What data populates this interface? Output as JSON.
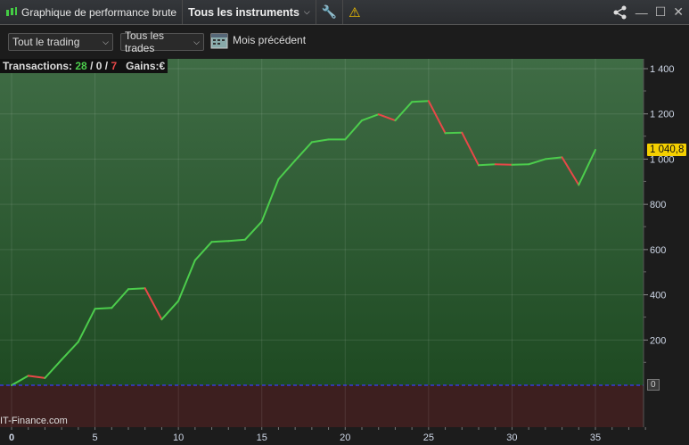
{
  "titlebar": {
    "title": "Graphique de performance brute",
    "instruments": "Tous les instruments"
  },
  "toolbar": {
    "scope": "Tout le trading",
    "trades": "Tous les trades",
    "period": "Mois précédent"
  },
  "stats": {
    "label": "Transactions:",
    "wins": "28",
    "sep1": " / ",
    "neutral": "0",
    "sep2": " / ",
    "losses": "7",
    "gains_label": "Gains:€"
  },
  "watermark": "IT-Finance.com",
  "colors": {
    "up": "#4ccd4c",
    "down": "#e84848",
    "wins": "#4ccd4c",
    "losses": "#e84848"
  },
  "chart_data": {
    "type": "line",
    "x": [
      0,
      1,
      2,
      3,
      4,
      5,
      6,
      7,
      8,
      9,
      10,
      11,
      12,
      13,
      14,
      15,
      16,
      17,
      18,
      19,
      20,
      21,
      22,
      23,
      24,
      25,
      26,
      27,
      28,
      29,
      30,
      31,
      32,
      33,
      34,
      35
    ],
    "values": [
      0,
      42,
      32,
      113,
      192,
      338,
      342,
      425,
      429,
      291,
      373,
      553,
      634,
      638,
      644,
      724,
      911,
      994,
      1075,
      1087,
      1087,
      1171,
      1198,
      1171,
      1253,
      1257,
      1115,
      1117,
      973,
      977,
      975,
      977,
      1000,
      1008,
      886,
      1040.8
    ],
    "last_value_label": "1 040,8",
    "zero_label": "0",
    "xlim": [
      0,
      38
    ],
    "ylim": [
      -180,
      1460
    ],
    "xticks": [
      "0",
      "5",
      "10",
      "15",
      "20",
      "25",
      "30",
      "35"
    ],
    "yticks": [
      {
        "v": 1400,
        "label": "1 400"
      },
      {
        "v": 1200,
        "label": "1 200"
      },
      {
        "v": 1000,
        "label": "1 000"
      },
      {
        "v": 800,
        "label": "800"
      },
      {
        "v": 600,
        "label": "600"
      },
      {
        "v": 400,
        "label": "400"
      },
      {
        "v": 200,
        "label": "200"
      }
    ],
    "grid": true
  }
}
